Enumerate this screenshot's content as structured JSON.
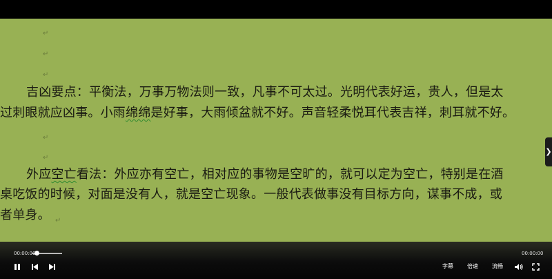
{
  "document": {
    "para1": {
      "line1": "吉凶要点：平衡法，万事万物法则一致，凡事不可太过。光明代表好运，贵人，但是太",
      "line2_a": "过刺眼就应凶事。小雨",
      "line2_sq": "绵绵",
      "line2_b": "是好事，大雨倾盆就不好。声音轻柔悦耳代表吉祥，刺耳就不好。"
    },
    "para2": {
      "line1_a": "外应",
      "line1_sq": "空亡",
      "line1_b": "看法：外应亦有空亡，相对应的事物是空旷的，就可以定为空亡，特别是在酒",
      "line2": "桌吃饭的时候，对面是没有人，就是空亡现象。一般代表做事没有目标方向，谋事不成，或",
      "line3": "者单身。"
    },
    "para_mark": "↵"
  },
  "player": {
    "current_time": "00:00:00",
    "total_time": "00:00:00",
    "progress": 0.0,
    "subtitle_label": "字幕",
    "speed_label": "倍速",
    "quality_label": "流畅"
  },
  "colors": {
    "doc_background": "#98b154",
    "player_background": "#050505"
  }
}
